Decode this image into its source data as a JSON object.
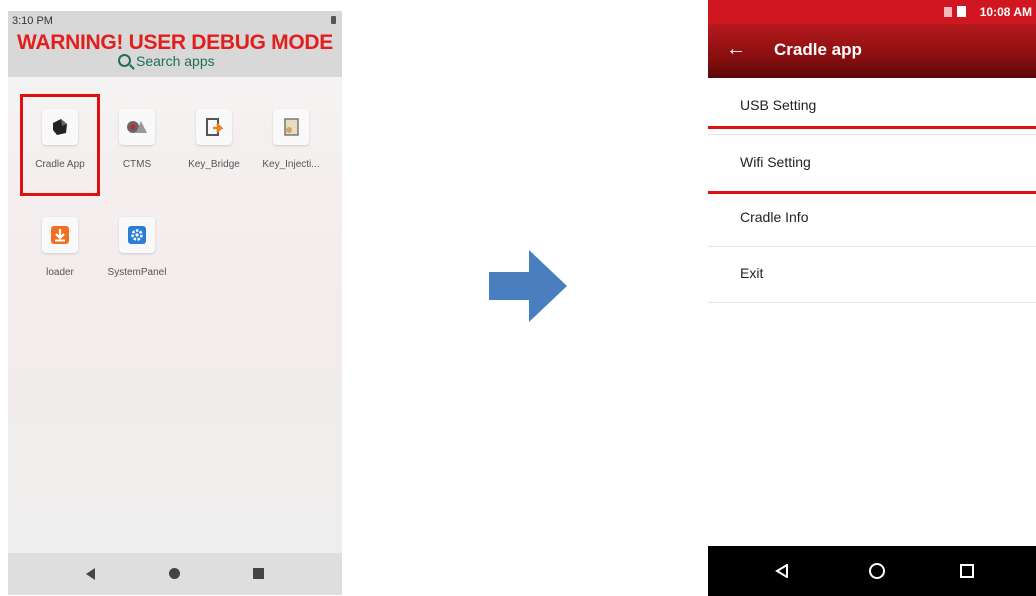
{
  "left_phone": {
    "status_time": "3:10 PM",
    "warning": "WARNING! USER DEBUG MODE",
    "search_label": "Search apps",
    "apps": [
      {
        "label": "Cradle App",
        "icon": "cradle-app-icon"
      },
      {
        "label": "CTMS",
        "icon": "ctms-icon"
      },
      {
        "label": "Key_Bridge",
        "icon": "key-bridge-icon"
      },
      {
        "label": "Key_Injecti...",
        "icon": "key-injection-icon"
      },
      {
        "label": "loader",
        "icon": "loader-icon"
      },
      {
        "label": "SystemPanel",
        "icon": "system-panel-icon"
      }
    ]
  },
  "right_phone": {
    "status_time": "10:08 AM",
    "title": "Cradle app",
    "menu": [
      {
        "label": "USB Setting"
      },
      {
        "label": "Wifi Setting"
      },
      {
        "label": "Cradle Info"
      },
      {
        "label": "Exit"
      }
    ]
  },
  "colors": {
    "warning": "#e11f1f",
    "highlight": "#e01010",
    "arrow": "#4a7fbf",
    "header_red": "#b51a1e"
  }
}
